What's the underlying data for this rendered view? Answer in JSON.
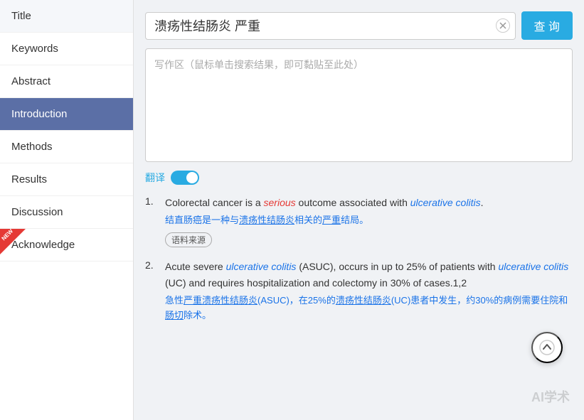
{
  "sidebar": {
    "items": [
      {
        "id": "title",
        "label": "Title",
        "active": false
      },
      {
        "id": "keywords",
        "label": "Keywords",
        "active": false
      },
      {
        "id": "abstract",
        "label": "Abstract",
        "active": false
      },
      {
        "id": "introduction",
        "label": "Introduction",
        "active": true
      },
      {
        "id": "methods",
        "label": "Methods",
        "active": false
      },
      {
        "id": "results",
        "label": "Results",
        "active": false
      },
      {
        "id": "discussion",
        "label": "Discussion",
        "active": false
      },
      {
        "id": "acknowledge",
        "label": "Acknowledge",
        "active": false,
        "new": true
      }
    ]
  },
  "search": {
    "query": "溃疡性结肠炎 严重",
    "clear_title": "清除",
    "button_label": "查 询",
    "placeholder": "写作区（鼠标单击搜索结果，即可黏贴至此处）"
  },
  "translate": {
    "label": "翻译"
  },
  "results": [
    {
      "num": "1.",
      "en_parts": [
        {
          "text": "Colorectal cancer is a ",
          "style": "normal"
        },
        {
          "text": "serious",
          "style": "italic-red"
        },
        {
          "text": " outcome associated with ",
          "style": "normal"
        },
        {
          "text": "ulcerative colitis",
          "style": "italic-blue"
        },
        {
          "text": ".",
          "style": "normal"
        }
      ],
      "cn": "结直肠癌是一种与溃疡性结肠炎相关的严重结局。",
      "source": "语料来源"
    },
    {
      "num": "2.",
      "en_parts": [
        {
          "text": "Acute severe ",
          "style": "normal"
        },
        {
          "text": "ulcerative colitis",
          "style": "italic-blue"
        },
        {
          "text": " (ASUC), occurs in up to 25% of patients with ",
          "style": "normal"
        },
        {
          "text": "ulcerative colitis",
          "style": "italic-blue"
        },
        {
          "text": " (UC) and requires hospitalization and colectomy in 30% of cases.1,2",
          "style": "normal"
        }
      ],
      "cn": "急性严重溃疡性结肠炎(ASUC)，在25%的溃疡性结肠炎(UC)患者中发生，约30%的病例需要住院和肠切除术。",
      "source": null
    }
  ],
  "watermark": "AI学术",
  "float_up": "↑"
}
